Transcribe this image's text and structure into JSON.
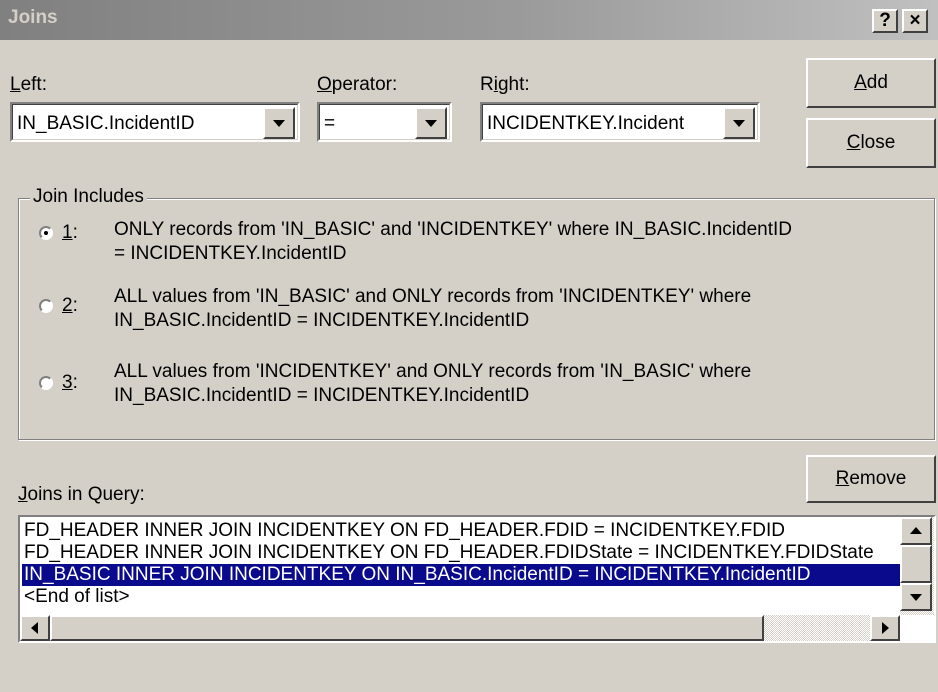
{
  "window": {
    "title": "Joins",
    "help_label": "?",
    "close_label": "×"
  },
  "left": {
    "label_prefix": "",
    "label_mnemonic": "L",
    "label_rest": "eft:",
    "value": "IN_BASIC.IncidentID"
  },
  "operator": {
    "label_mnemonic": "O",
    "label_rest": "perator:",
    "value": "="
  },
  "right": {
    "label_prefix": "R",
    "label_mnemonic": "i",
    "label_rest": "ght:",
    "value": "INCIDENTKEY.Incident"
  },
  "buttons": {
    "add_mnemonic": "A",
    "add_rest": "dd",
    "close_mnemonic": "C",
    "close_rest": "lose",
    "remove_mnemonic": "R",
    "remove_rest": "emove"
  },
  "join_includes": {
    "title": "Join Includes",
    "options": [
      {
        "num_mnemonic": "1",
        "num_rest": ":",
        "selected": true,
        "line1": "ONLY records from 'IN_BASIC' and 'INCIDENTKEY' where IN_BASIC.IncidentID",
        "line2": "= INCIDENTKEY.IncidentID"
      },
      {
        "num_mnemonic": "2",
        "num_rest": ":",
        "selected": false,
        "line1": "ALL values from 'IN_BASIC' and ONLY records from 'INCIDENTKEY' where",
        "line2": "IN_BASIC.IncidentID = INCIDENTKEY.IncidentID"
      },
      {
        "num_mnemonic": "3",
        "num_rest": ":",
        "selected": false,
        "line1": "ALL values from 'INCIDENTKEY' and ONLY records from 'IN_BASIC' where",
        "line2": "IN_BASIC.IncidentID = INCIDENTKEY.IncidentID"
      }
    ]
  },
  "joins_list": {
    "label_mnemonic": "J",
    "label_rest": "oins in Query:",
    "items": [
      "FD_HEADER INNER JOIN INCIDENTKEY ON FD_HEADER.FDID = INCIDENTKEY.FDID",
      "FD_HEADER INNER JOIN INCIDENTKEY ON FD_HEADER.FDIDState = INCIDENTKEY.FDIDState",
      "IN_BASIC INNER JOIN INCIDENTKEY ON IN_BASIC.IncidentID = INCIDENTKEY.IncidentID",
      "<End of list>"
    ],
    "selected_index": 2
  },
  "colors": {
    "face": "#d4d0c8",
    "selection": "#0a0a8c",
    "titlebar_start": "#808080",
    "titlebar_end": "#c0c0c0"
  }
}
